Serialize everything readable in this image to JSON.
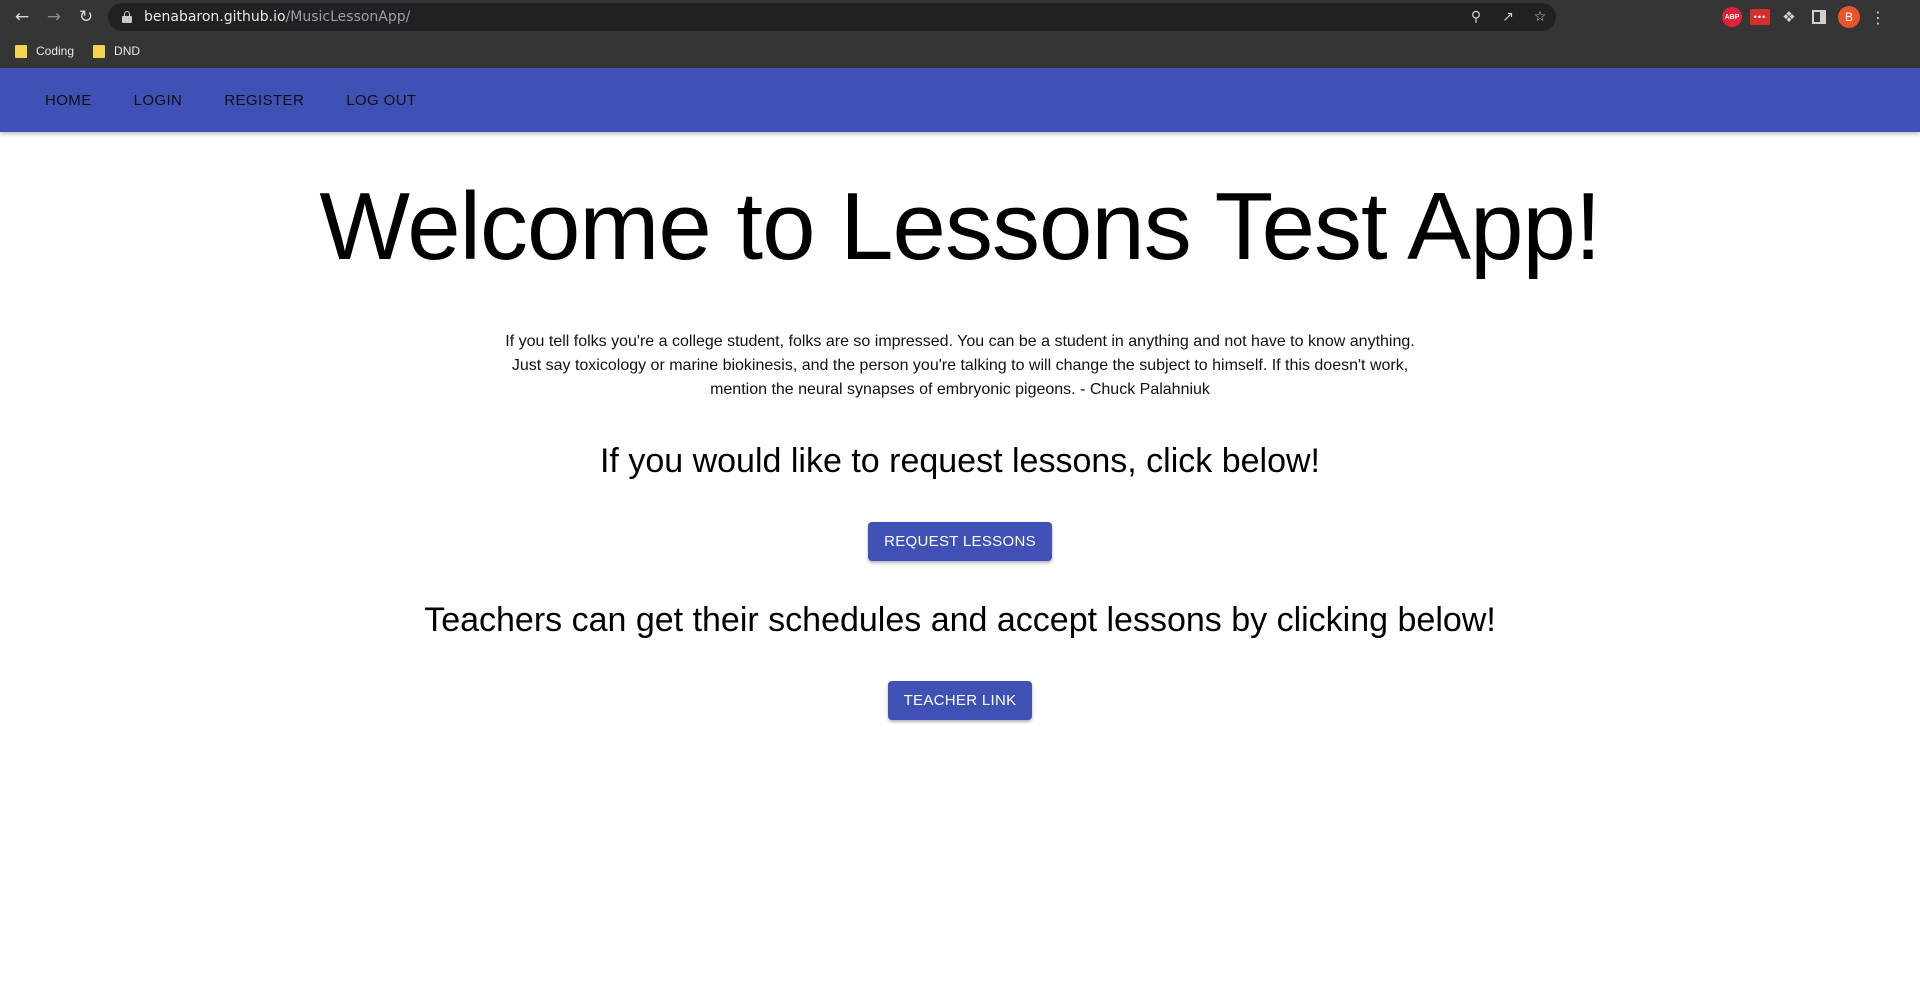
{
  "browser": {
    "url_host": "benabaron.github.io",
    "url_path": "/MusicLessonApp/",
    "avatar_letter": "B",
    "abp_label": "ABP",
    "lp_label": "•••",
    "bookmarks": [
      {
        "label": "Coding"
      },
      {
        "label": "DND"
      }
    ]
  },
  "navbar": {
    "items": [
      {
        "label": "Home"
      },
      {
        "label": "Login"
      },
      {
        "label": "Register"
      },
      {
        "label": "Log out"
      }
    ]
  },
  "main": {
    "title": "Welcome to Lessons Test App!",
    "quote": "If you tell folks you're a college student, folks are so impressed. You can be a student in anything and not have to know anything. Just say toxicology or marine biokinesis, and the person you're talking to will change the subject to himself. If this doesn't work, mention the neural synapses of embryonic pigeons. - Chuck Palahniuk",
    "request_heading": "If you would like to request lessons, click below!",
    "request_button": "Request Lessons",
    "teacher_heading": "Teachers can get their schedules and accept lessons by clicking below!",
    "teacher_button": "Teacher Link"
  },
  "colors": {
    "appbar": "#3f51b5",
    "button": "#3f51b5",
    "chrome": "#353535"
  }
}
